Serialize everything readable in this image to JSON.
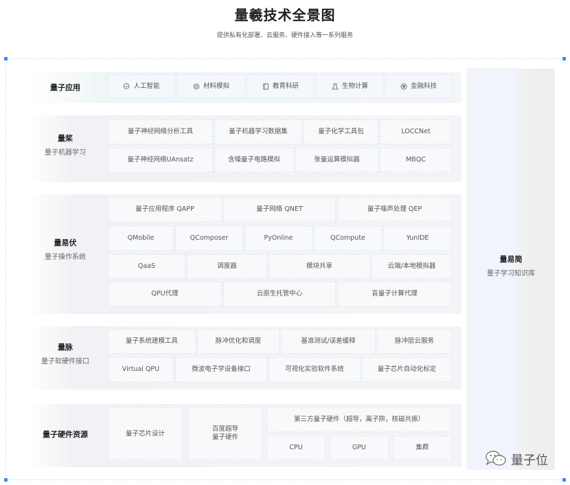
{
  "header": {
    "title": "量羲技术全景图",
    "subtitle": "提供私有化部署、云服务、硬件接入等一系列服务"
  },
  "layers": {
    "app": {
      "name": "量子应用",
      "items": [
        {
          "label": "人工智能",
          "icon": "lightbulb-icon"
        },
        {
          "label": "材料模拟",
          "icon": "atom-icon"
        },
        {
          "label": "教育科研",
          "icon": "book-icon"
        },
        {
          "label": "生物计算",
          "icon": "flask-icon"
        },
        {
          "label": "金融科技",
          "icon": "shield-icon"
        }
      ]
    },
    "ml": {
      "name": "量桨",
      "sub": "量子机器学习",
      "rows": [
        [
          "量子神经网络分析工具",
          "量子机器学习数据集",
          "量子化学工具包",
          "LOCCNet"
        ],
        [
          "量子神经网络UAnsatz",
          "含噪量子电路模拟",
          "张量运算模拟器",
          "MBQC"
        ]
      ]
    },
    "os": {
      "name": "量易伏",
      "sub": "量子操作系统",
      "rows": [
        [
          "量子应用程序 QAPP",
          "量子网络 QNET",
          "量子噪声处理 QEP"
        ],
        [
          "QMobile",
          "QComposer",
          "PyOnline",
          "QCompute",
          "YunIDE"
        ],
        [
          "QaaS",
          "调度器",
          "模块共享",
          "云端/本地模拟器"
        ],
        [
          "QPU代理",
          "云原生托管中心",
          "盲量子计算代理"
        ]
      ]
    },
    "pulse": {
      "name": "量脉",
      "sub": "量子软硬件接口",
      "rows": [
        [
          "量子系统建模工具",
          "脉冲优化和调度",
          "基准测试/误差缓释",
          "脉冲层云服务"
        ],
        [
          "Virtual QPU",
          "微波电子学设备接口",
          "可视化实验软件系统",
          "量子芯片自动化标定"
        ]
      ]
    },
    "hw": {
      "name": "量子硬件资源",
      "chip": "量子芯片设计",
      "baidu": "百度超导\n量子硬件",
      "third_party": "第三方量子硬件（超导，离子阱，核磁共振）",
      "classical": [
        "CPU",
        "GPU",
        "集群"
      ]
    }
  },
  "side": {
    "name": "量易简",
    "sub": "量子学习知识库"
  },
  "watermark": {
    "text": "量子位",
    "icon": "wechat-icon"
  },
  "colors": {
    "handle": "#3b8cf3"
  }
}
